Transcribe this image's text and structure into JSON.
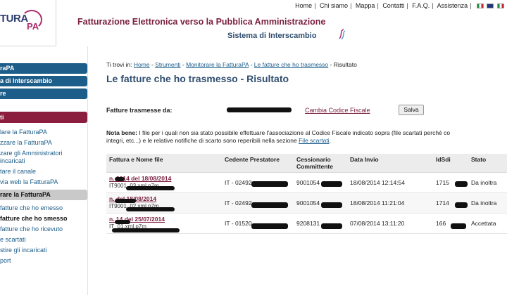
{
  "logo": {
    "main": "TURA",
    "accent": "PA"
  },
  "topnav": {
    "items": [
      "Home",
      "Chi siamo",
      "Mappa",
      "Contatti",
      "F.A.Q.",
      "Assistenza"
    ]
  },
  "header": {
    "title": "Fatturazione Elettronica verso la Pubblica Amministrazione",
    "subtitle": "Sistema di Interscambio"
  },
  "sidebar": {
    "blue_items": [
      "raPA",
      "a di Interscambio",
      "re"
    ],
    "red_header": "ti",
    "links": [
      "lare la FatturaPA",
      "zzare la FatturaPA",
      "zare gli Amministratori incaricati",
      "tare il canale",
      "via web la FatturaPA"
    ],
    "active": "rare la FatturaPA",
    "sub_links": [
      "fatture che ho emesso"
    ],
    "sub_active": "fatture che ho smesso",
    "more_links": [
      "fatture che ho ricevuto",
      "e scartati",
      "stire gli incaricati",
      "port"
    ]
  },
  "breadcrumb": {
    "prefix": "Ti trovi in:",
    "links": [
      "Home",
      "Strumenti",
      "Monitorare la FatturaPA",
      "Le fatture che ho trasmesso"
    ],
    "current": "Risultato"
  },
  "page_title": "Le fatture che ho trasmesso - Risultato",
  "sender": {
    "label": "Fatture trasmesse da:",
    "change_link": "Cambia Codice Fiscale",
    "save_label": "Salva"
  },
  "note": {
    "bold": "Nota bene:",
    "text1": "I file per i quali non sia stato possibile effettuare l'associazione al Codice Fiscale indicato sopra (file scartati perché co",
    "text2": "integri, etc...) e le relative notifiche di scarto sono reperibili nella sezione",
    "link": "File scartati",
    "end": "."
  },
  "table": {
    "headers": [
      "Fattura e Nome file",
      "Cedente Prestatore",
      "Cessionario Committente",
      "Data Invio",
      "IdSdi",
      "Stato"
    ],
    "rows": [
      {
        "invoice": "n. 2014 del 18/08/2014",
        "file": "IT9001_03.xml.p7m",
        "cedente": "IT - 02492",
        "cessionario": "9001054",
        "date": "18/08/2014 12:14:54",
        "idsdi": "1715",
        "status": "Da inoltra"
      },
      {
        "invoice": "n. del 18/08/2014",
        "file": "IT9001_02.xml.p7m",
        "cedente": "IT - 02492",
        "cessionario": "9001054",
        "date": "18/08/2014 11:21:04",
        "idsdi": "1714",
        "status": "Da inoltra"
      },
      {
        "invoice": "n. 14 del 25/07/2014",
        "file": "IT_01.xml.p7m",
        "cedente": "IT - 01520",
        "cessionario": "9208131",
        "date": "07/08/2014 13:11:20",
        "idsdi": "166",
        "status": "Accettata"
      }
    ]
  }
}
